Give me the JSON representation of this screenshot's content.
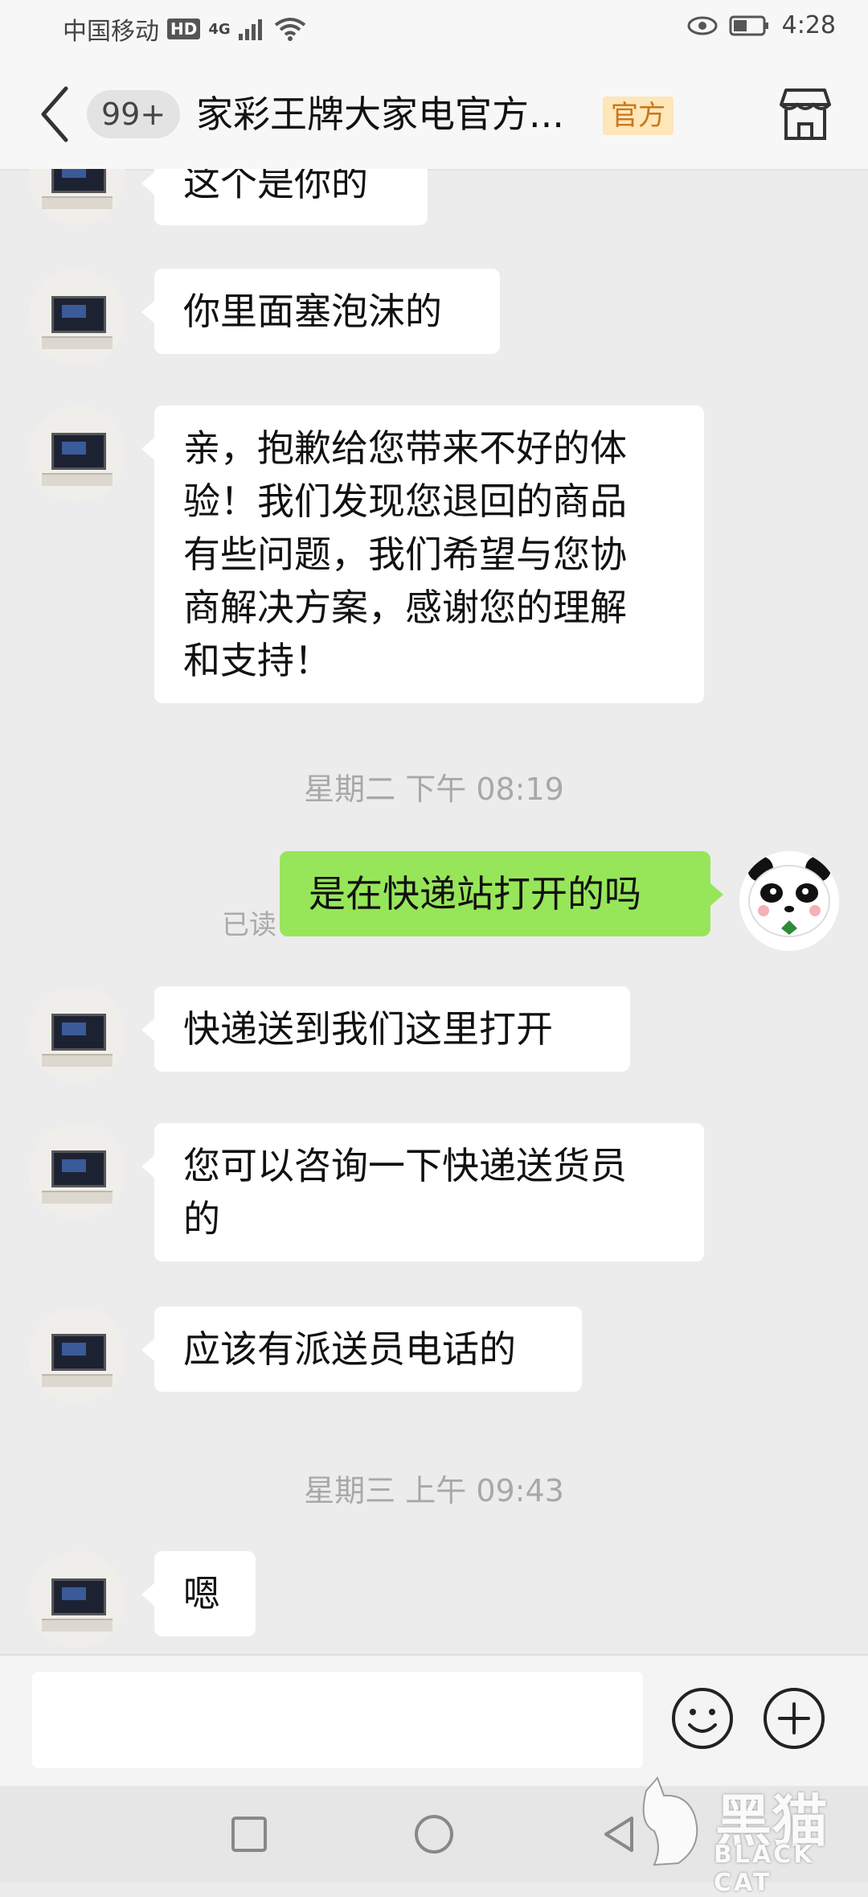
{
  "status_bar": {
    "carrier": "中国移动",
    "hd": "HD",
    "network": "4G",
    "time": "4:28"
  },
  "header": {
    "unread_count": "99+",
    "title": "家彩王牌大家电官方...",
    "badge": "官方"
  },
  "messages": [
    {
      "side": "them",
      "text": "这个是你的"
    },
    {
      "side": "them",
      "text": "你里面塞泡沫的"
    },
    {
      "side": "them",
      "lines": [
        "亲，抱歉给您带来不好的体",
        "验！我们发现您退回的商品",
        "有些问题，我们希望与您协",
        "商解决方案，感谢您的理解",
        "和支持！"
      ]
    },
    {
      "side": "time",
      "text": "星期二 下午 08:19"
    },
    {
      "side": "me",
      "text": "是在快递站打开的吗",
      "status": "已读"
    },
    {
      "side": "them",
      "text": "快递送到我们这里打开"
    },
    {
      "side": "them",
      "lines": [
        "您可以咨询一下快递送货员",
        "的"
      ]
    },
    {
      "side": "them",
      "text": "应该有派送员电话的"
    },
    {
      "side": "time",
      "text": "星期三 上午 09:43"
    },
    {
      "side": "them",
      "text": "嗯"
    }
  ],
  "watermark": {
    "text": "黑猫",
    "subtext": "BLACK CAT"
  },
  "icons": {
    "back": "chevron-left-icon",
    "store": "store-icon",
    "emoji": "smiley-icon",
    "add": "plus-circle-icon"
  }
}
